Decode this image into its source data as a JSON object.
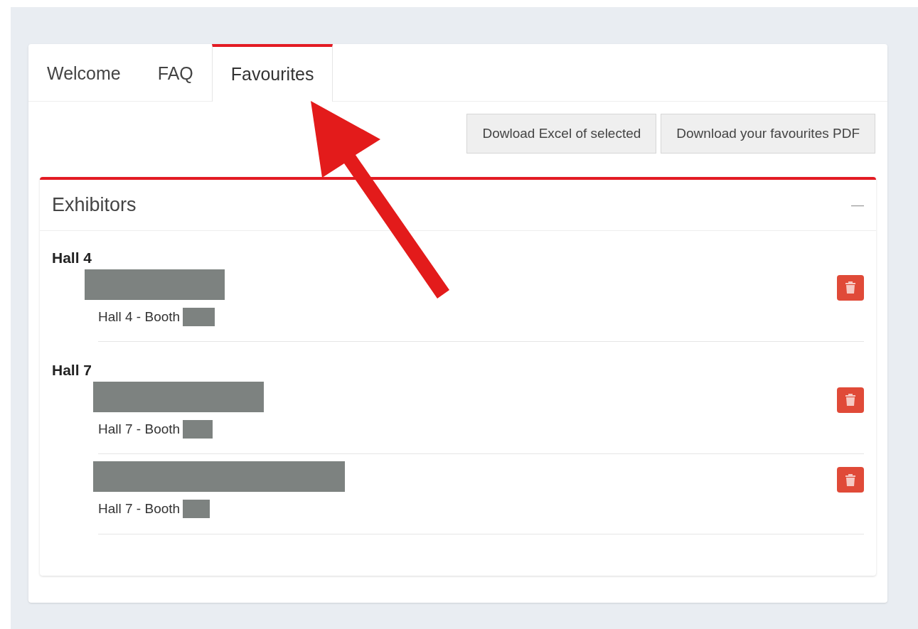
{
  "tabs": [
    {
      "label": "Welcome",
      "selected": false
    },
    {
      "label": "FAQ",
      "selected": false
    },
    {
      "label": "Favourites",
      "selected": true
    }
  ],
  "buttons": [
    "Dowload Excel of selected",
    "Download your favourites PDF"
  ],
  "panel": {
    "title": "Exhibitors",
    "collapse_symbol": "—",
    "groups": [
      {
        "hall": "Hall 4",
        "items": [
          {
            "booth": "Hall 4 - Booth"
          }
        ]
      },
      {
        "hall": "Hall 7",
        "items": [
          {
            "booth": "Hall 7 - Booth"
          },
          {
            "booth": "Hall 7 - Booth"
          }
        ]
      }
    ]
  }
}
